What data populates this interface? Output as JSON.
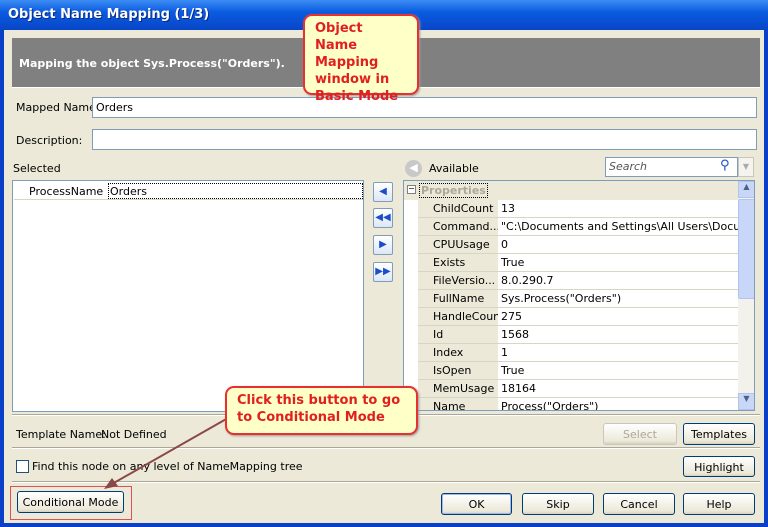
{
  "window": {
    "title": "Object Name Mapping (1/3)"
  },
  "header": {
    "text": "Mapping the object Sys.Process(\"Orders\")."
  },
  "form": {
    "mapped_name_label": "Mapped Name:",
    "mapped_name_value": "Orders",
    "description_label": "Description:",
    "description_value": ""
  },
  "selected": {
    "label": "Selected",
    "rows": [
      {
        "name": "ProcessName",
        "value": "Orders"
      }
    ]
  },
  "available": {
    "label": "Available",
    "search_placeholder": "Search",
    "group": "Properties",
    "rows": [
      {
        "name": "ChildCount",
        "value": "13"
      },
      {
        "name": "Command...",
        "value": "\"C:\\Documents and Settings\\All Users\\Docume..."
      },
      {
        "name": "CPUUsage",
        "value": "0"
      },
      {
        "name": "Exists",
        "value": "True"
      },
      {
        "name": "FileVersio...",
        "value": "8.0.290.7"
      },
      {
        "name": "FullName",
        "value": "Sys.Process(\"Orders\")"
      },
      {
        "name": "HandleCount",
        "value": "275"
      },
      {
        "name": "Id",
        "value": "1568"
      },
      {
        "name": "Index",
        "value": "1"
      },
      {
        "name": "IsOpen",
        "value": "True"
      },
      {
        "name": "MemUsage",
        "value": "18164"
      },
      {
        "name": "Name",
        "value": "Process(\"Orders\")"
      }
    ]
  },
  "template": {
    "label": "Template Name:",
    "value": "Not Defined",
    "select": "Select",
    "templates": "Templates"
  },
  "find": {
    "label": "Find this node on any level of NameMapping tree",
    "checked": false,
    "highlight": "Highlight"
  },
  "buttons": {
    "conditional": "Conditional Mode",
    "ok": "OK",
    "skip": "Skip",
    "cancel": "Cancel",
    "help": "Help"
  },
  "callouts": {
    "top": "Object Name Mapping window in Basic Mode",
    "bottom": "Click this button to go to Conditional Mode"
  },
  "colors": {
    "callout_text": "#e02020",
    "callout_bg": "#ffffc8",
    "header_bg": "#808080"
  }
}
